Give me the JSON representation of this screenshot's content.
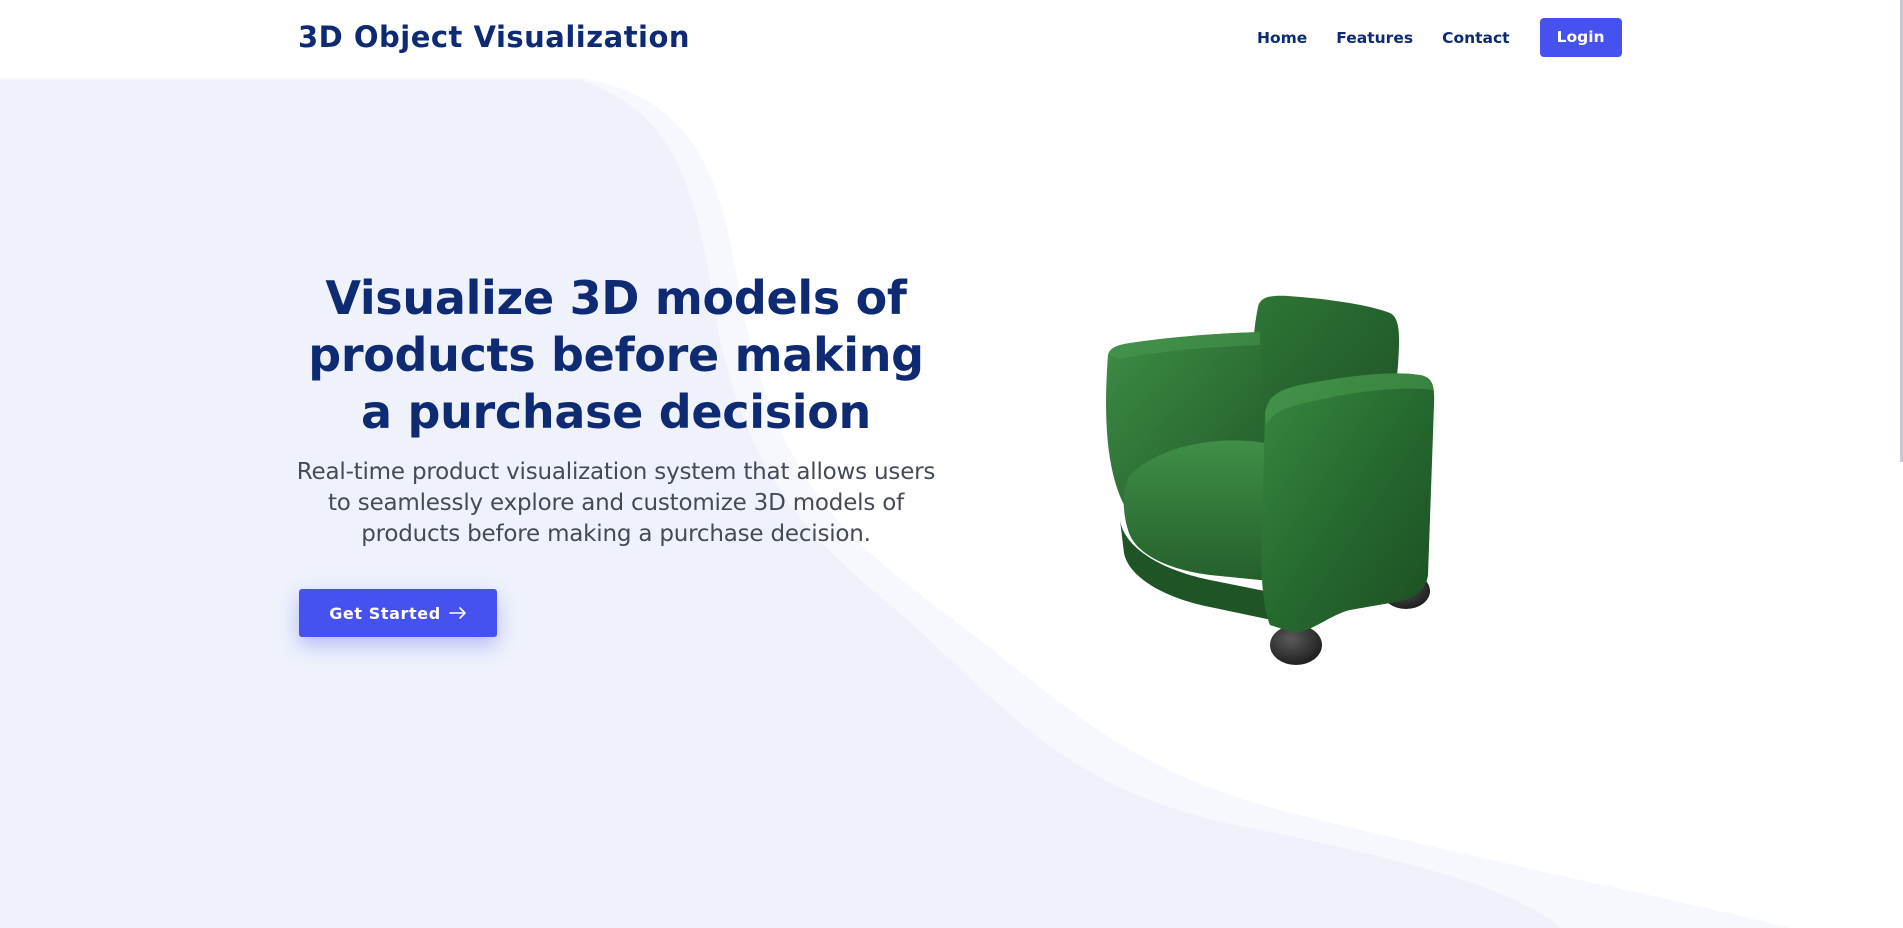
{
  "navbar": {
    "brand": "3D Object Visualization",
    "links": [
      "Home",
      "Features",
      "Contact"
    ],
    "login_label": "Login"
  },
  "hero": {
    "title": "Visualize 3D models of products before making a purchase decision",
    "subtitle": "Real-time product visualization system that allows users to seamlessly explore and customize 3D models of products before making a purchase decision.",
    "cta_label": "Get Started",
    "cta_icon": "arrow-right-icon"
  },
  "model": {
    "icon": "armchair-3d-model",
    "color": "#2b6b32"
  },
  "colors": {
    "brand": "#0d2a73",
    "accent": "#4652ef",
    "background_wave": "#eff2fb",
    "background_wave_light": "#f5f7fc"
  }
}
